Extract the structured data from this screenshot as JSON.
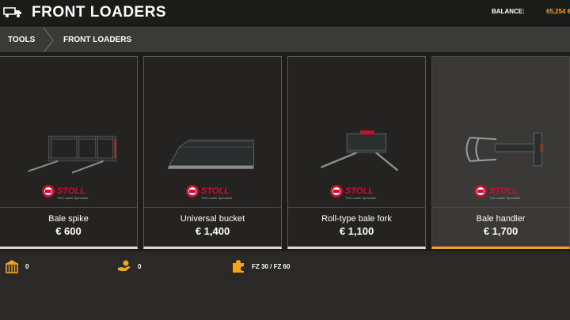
{
  "header": {
    "title": "FRONT LOADERS",
    "balance_label": "BALANCE:",
    "balance_value": "65,254 €"
  },
  "breadcrumb": {
    "items": [
      "TOOLS",
      "FRONT LOADERS"
    ]
  },
  "shop_items": [
    {
      "name": "Bale spike",
      "price": "€ 600",
      "brand": "STOLL",
      "brand_tagline": "The Loader Specialist"
    },
    {
      "name": "Universal bucket",
      "price": "€ 1,400",
      "brand": "STOLL",
      "brand_tagline": "The Loader Specialist"
    },
    {
      "name": "Roll-type bale fork",
      "price": "€ 1,100",
      "brand": "STOLL",
      "brand_tagline": "The Loader Specialist"
    },
    {
      "name": "Bale handler",
      "price": "€ 1,700",
      "brand": "STOLL",
      "brand_tagline": "The Loader Specialist"
    }
  ],
  "selected_item": "Bale handler",
  "stats": [
    {
      "icon": "crate-icon",
      "value": "0"
    },
    {
      "icon": "hand-coin-icon",
      "value": "0"
    },
    {
      "icon": "puzzle-icon",
      "value": "FZ 30 / FZ 60"
    }
  ],
  "colors": {
    "accent": "#f2a41c",
    "brand_red": "#c8102e",
    "panel": "#242322",
    "panel_selected": "#3a3938"
  }
}
